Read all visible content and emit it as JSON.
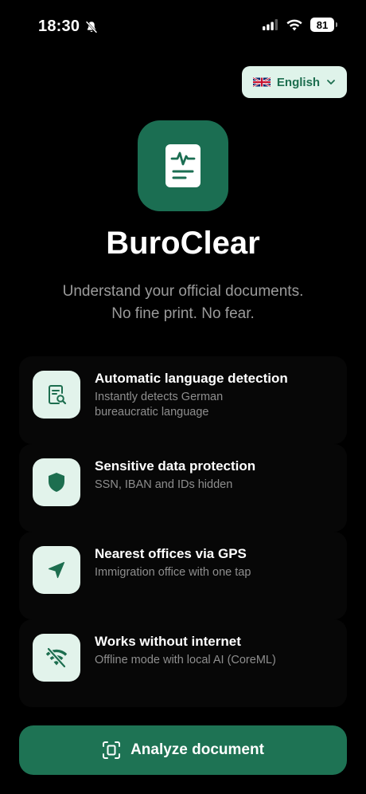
{
  "status_bar": {
    "time": "18:30",
    "battery": "81",
    "icons": [
      "bell-slash-icon",
      "signal-icon",
      "wifi-icon",
      "battery-icon"
    ]
  },
  "language": {
    "label": "English",
    "flag": "uk-flag-icon"
  },
  "app": {
    "name": "BuroClear",
    "tagline_line1": "Understand your official documents.",
    "tagline_line2": "No fine print. No fear."
  },
  "features": [
    {
      "title": "Automatic language detection",
      "description": "Instantly detects German bureaucratic language",
      "icon": "document-search-icon"
    },
    {
      "title": "Sensitive data protection",
      "description": "SSN, IBAN and IDs hidden",
      "icon": "shield-icon"
    },
    {
      "title": "Nearest offices via GPS",
      "description": "Immigration office with one tap",
      "icon": "location-arrow-icon"
    },
    {
      "title": "Works without internet",
      "description": "Offline mode with local AI (CoreML)",
      "icon": "wifi-off-icon"
    }
  ],
  "cta": {
    "label": "Analyze document",
    "icon": "scan-document-icon"
  },
  "colors": {
    "background": "#000000",
    "accent": "#1e7354",
    "accent_light": "#e2f3eb",
    "accent_text": "#1d6e4f",
    "muted_text": "#9b9b9b"
  }
}
